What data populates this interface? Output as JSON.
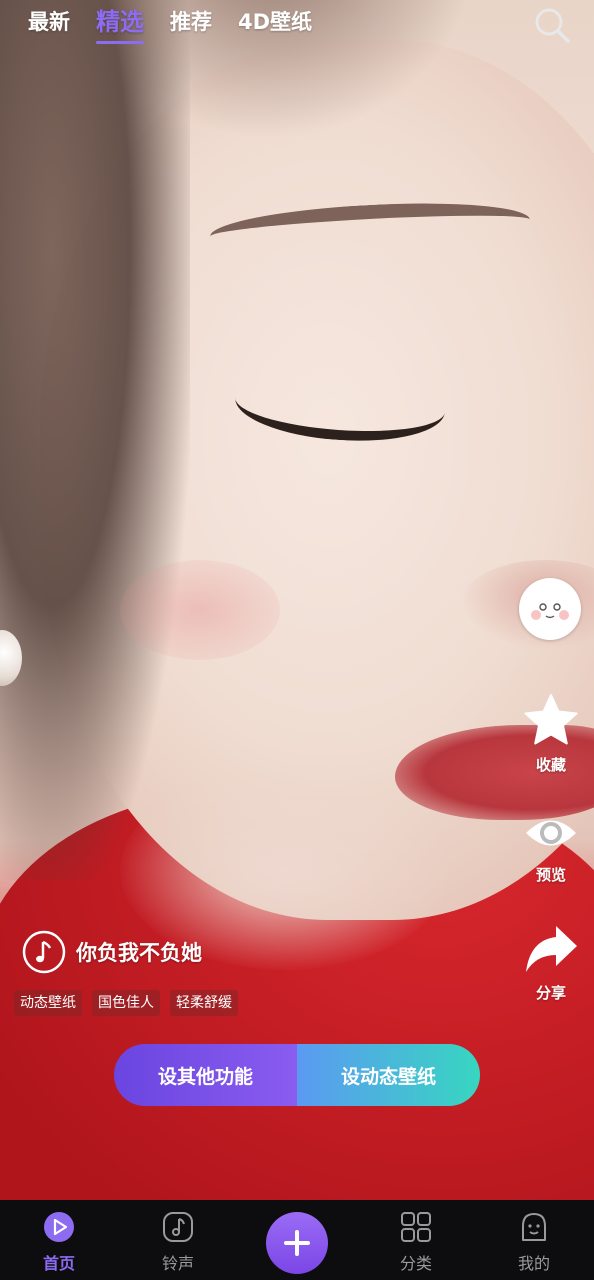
{
  "top_tabs": [
    {
      "label": "最新",
      "active": false
    },
    {
      "label": "精选",
      "active": true
    },
    {
      "label": "推荐",
      "active": false
    },
    {
      "label": "4D壁纸",
      "active": false
    }
  ],
  "top_search_icon": "search-icon",
  "side_actions": {
    "avatar_icon": "smiley-face-icon",
    "favorite": {
      "label": "收藏",
      "icon": "star-icon"
    },
    "preview": {
      "label": "预览",
      "icon": "eye-icon"
    },
    "share": {
      "label": "分享",
      "icon": "share-arrow-icon"
    }
  },
  "music": {
    "title": "你负我不负她",
    "icon": "music-note-icon"
  },
  "tags": [
    "动态壁纸",
    "国色佳人",
    "轻柔舒缓"
  ],
  "cta": {
    "left_label": "设其他功能",
    "right_label": "设动态壁纸"
  },
  "bottom_nav": [
    {
      "label": "首页",
      "icon": "play-home-icon",
      "active": true
    },
    {
      "label": "铃声",
      "icon": "music-note-icon",
      "active": false
    },
    {
      "label": "分类",
      "icon": "grid-icon",
      "active": false
    },
    {
      "label": "我的",
      "icon": "profile-icon",
      "active": false
    }
  ],
  "colors": {
    "accent": "#8d6cf2",
    "cta_left": "#7a52ea",
    "cta_right": "#42c6cc",
    "nav_bg": "#0d0d10"
  }
}
